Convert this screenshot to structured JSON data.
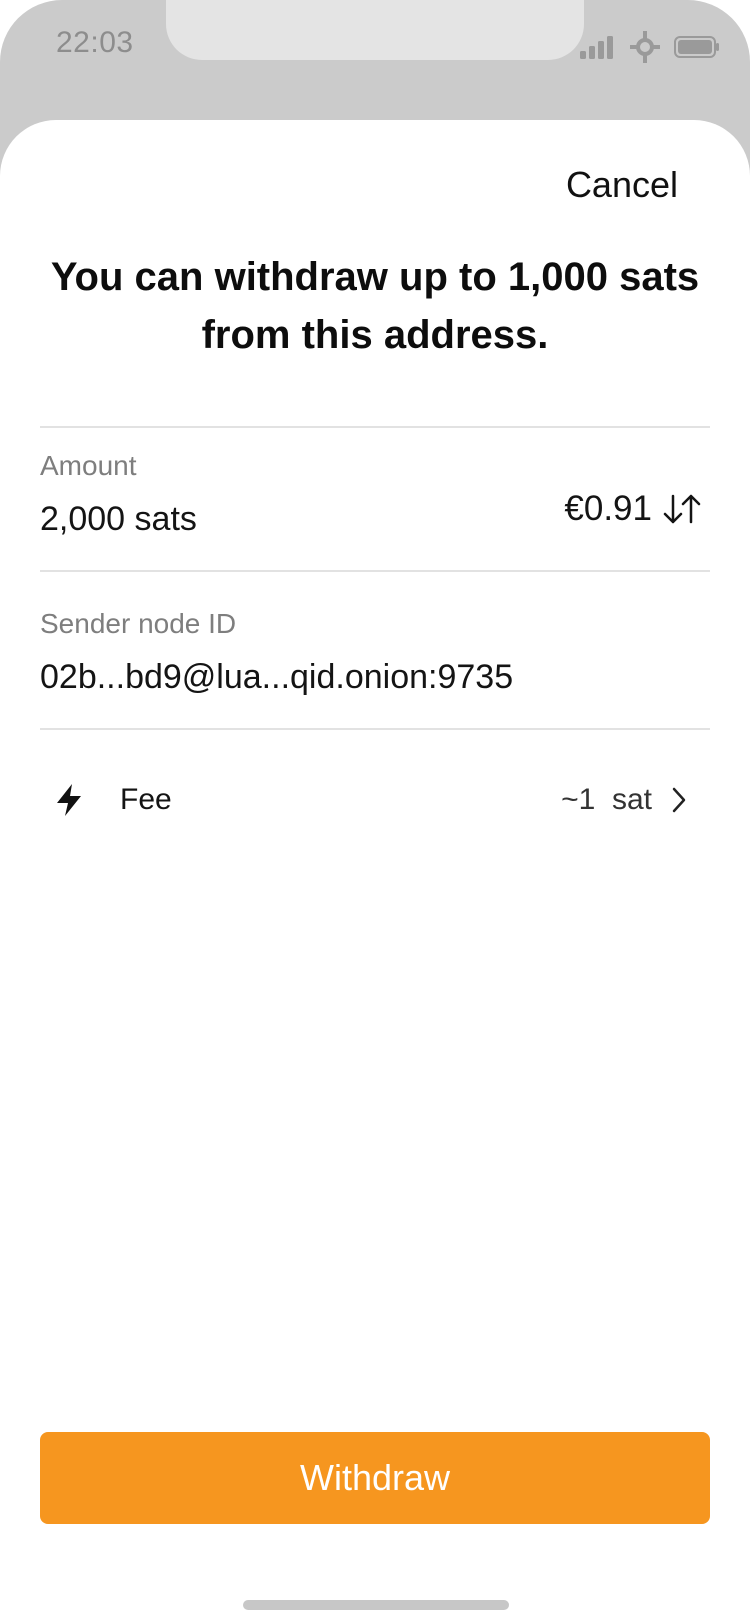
{
  "status_bar": {
    "time": "22:03",
    "icons": [
      "signal-icon",
      "network-icon",
      "battery-icon"
    ]
  },
  "sheet": {
    "cancel_label": "Cancel",
    "headline": "You can withdraw up to 1,000 sats from this address.",
    "amount": {
      "label": "Amount",
      "value": "2,000 sats",
      "fiat_value": "€0.91",
      "swap_icon": "swap-arrows-icon"
    },
    "sender": {
      "label": "Sender node ID",
      "value": "02b...bd9@lua...qid.onion:9735"
    },
    "fee": {
      "icon": "lightning-icon",
      "label": "Fee",
      "value": "~1  sat",
      "chevron_icon": "chevron-right-icon"
    },
    "withdraw_label": "Withdraw"
  },
  "colors": {
    "accent": "#f6961f",
    "status_bg": "#cbcbcb",
    "divider": "#e2e2e2"
  }
}
